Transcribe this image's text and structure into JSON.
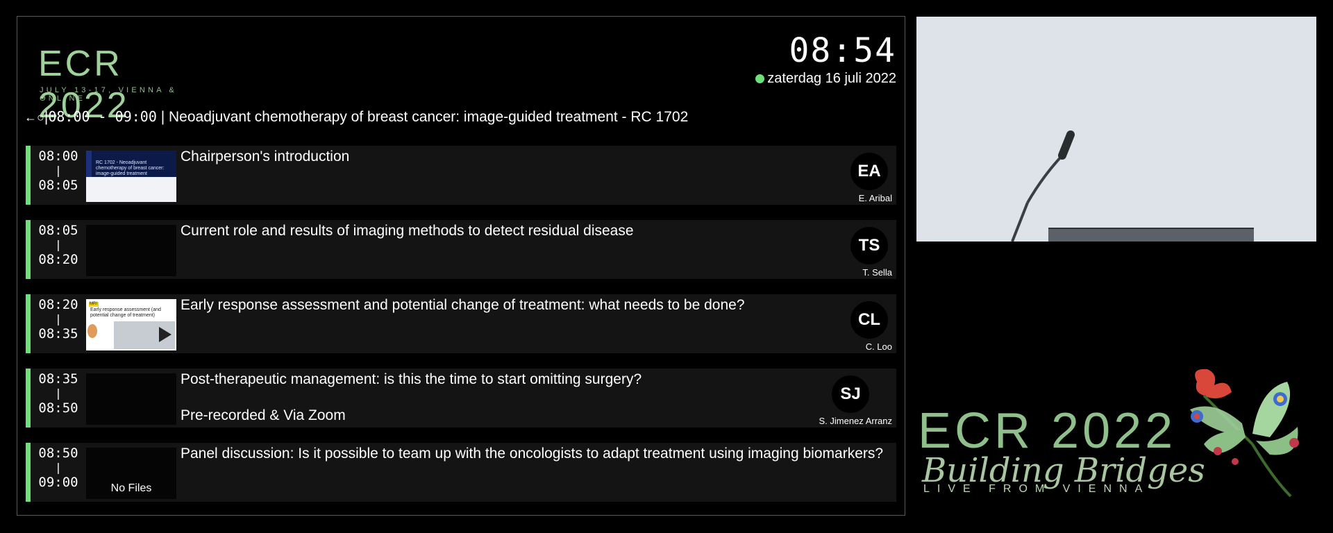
{
  "logo": {
    "main": "ECR 2022",
    "sub": "JULY 13-17, VIENNA & ONLINE"
  },
  "clock": {
    "time": "08:54",
    "date": "zaterdag 16 juli 2022",
    "status_color": "#6ee07a"
  },
  "session": {
    "back_icon": "back-icon",
    "time_range": "08:00 - 09:00",
    "title": "Neoadjuvant chemotherapy of breast cancer: image-guided treatment - RC 1702"
  },
  "talks": [
    {
      "start": "08:00",
      "end": "08:05",
      "title": "Chairperson's introduction",
      "subtitle": "",
      "initials": "EA",
      "speaker": "E. Aribal",
      "thumb_title": "RC 1702 - Neoadjuvant chemotherapy of breast cancer: image-guided treatment"
    },
    {
      "start": "08:05",
      "end": "08:20",
      "title": "Current role and results of imaging methods to detect residual disease",
      "subtitle": "",
      "initials": "TS",
      "speaker": "T. Sella"
    },
    {
      "start": "08:20",
      "end": "08:35",
      "title": "Early response assessment and potential change of treatment: what needs to be done?",
      "subtitle": "",
      "initials": "CL",
      "speaker": "C. Loo",
      "thumb_label": "MRI",
      "thumb_title": "Early response assessment (and potential change of treatment)"
    },
    {
      "start": "08:35",
      "end": "08:50",
      "title": "Post-therapeutic management: is this the time to start omitting surgery?",
      "subtitle": "Pre-recorded & Via Zoom",
      "initials": "SJ",
      "speaker": "S. Jimenez Arranz"
    },
    {
      "start": "08:50",
      "end": "09:00",
      "title": "Panel discussion: Is it possible to team up with the oncologists to adapt treatment using imaging biomarkers?",
      "subtitle": "",
      "no_files": "No Files"
    }
  ],
  "branding": {
    "main": "ECR 2022",
    "script": "Building Bridges",
    "sub": "LIVE FROM VIENNA"
  },
  "colors": {
    "accent": "#6ee07a",
    "logo_green": "#8fbf8a"
  }
}
